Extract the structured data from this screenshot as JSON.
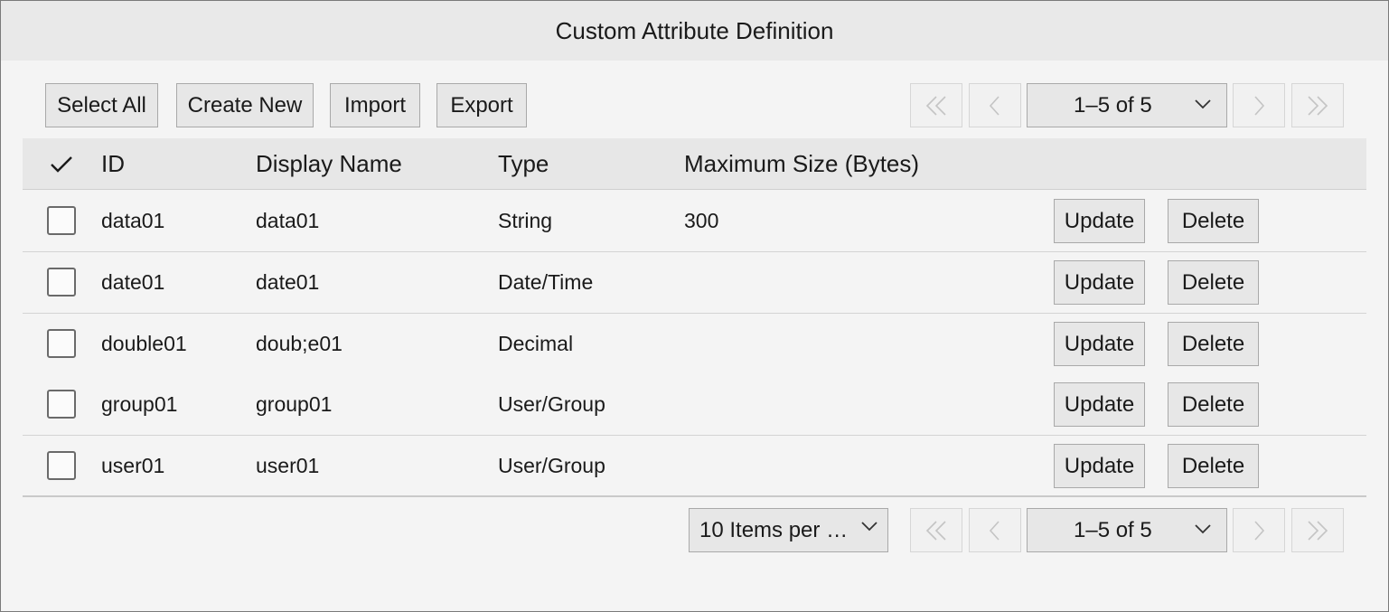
{
  "window": {
    "title": "Custom Attribute Definition"
  },
  "toolbar": {
    "select_all": "Select All",
    "create_new": "Create New",
    "import": "Import",
    "export": "Export"
  },
  "pager_top": {
    "range": "1–5 of 5"
  },
  "pager_bottom": {
    "range": "1–5 of 5",
    "items_per_page": "10 Items per …"
  },
  "table": {
    "columns": {
      "id": "ID",
      "display_name": "Display Name",
      "type": "Type",
      "max_size": "Maximum Size (Bytes)"
    },
    "rows": [
      {
        "id": "data01",
        "display_name": "data01",
        "type": "String",
        "max_size": "300",
        "update": "Update",
        "delete": "Delete"
      },
      {
        "id": "date01",
        "display_name": "date01",
        "type": "Date/Time",
        "max_size": "",
        "update": "Update",
        "delete": "Delete"
      },
      {
        "id": "double01",
        "display_name": "doub;e01",
        "type": "Decimal",
        "max_size": "",
        "update": "Update",
        "delete": "Delete"
      },
      {
        "id": "group01",
        "display_name": "group01",
        "type": "User/Group",
        "max_size": "",
        "update": "Update",
        "delete": "Delete"
      },
      {
        "id": "user01",
        "display_name": "user01",
        "type": "User/Group",
        "max_size": "",
        "update": "Update",
        "delete": "Delete"
      }
    ]
  },
  "icons": {
    "first": "first-page-icon",
    "prev": "prev-page-icon",
    "next": "next-page-icon",
    "last": "last-page-icon",
    "dropdown": "chevron-down-icon",
    "select_all_check": "checkmark-icon"
  },
  "colors": {
    "title_bar": "#e9e9e9",
    "background": "#f4f4f4",
    "button": "#e7e7e7",
    "disabled_text": "#c4c4c4"
  }
}
